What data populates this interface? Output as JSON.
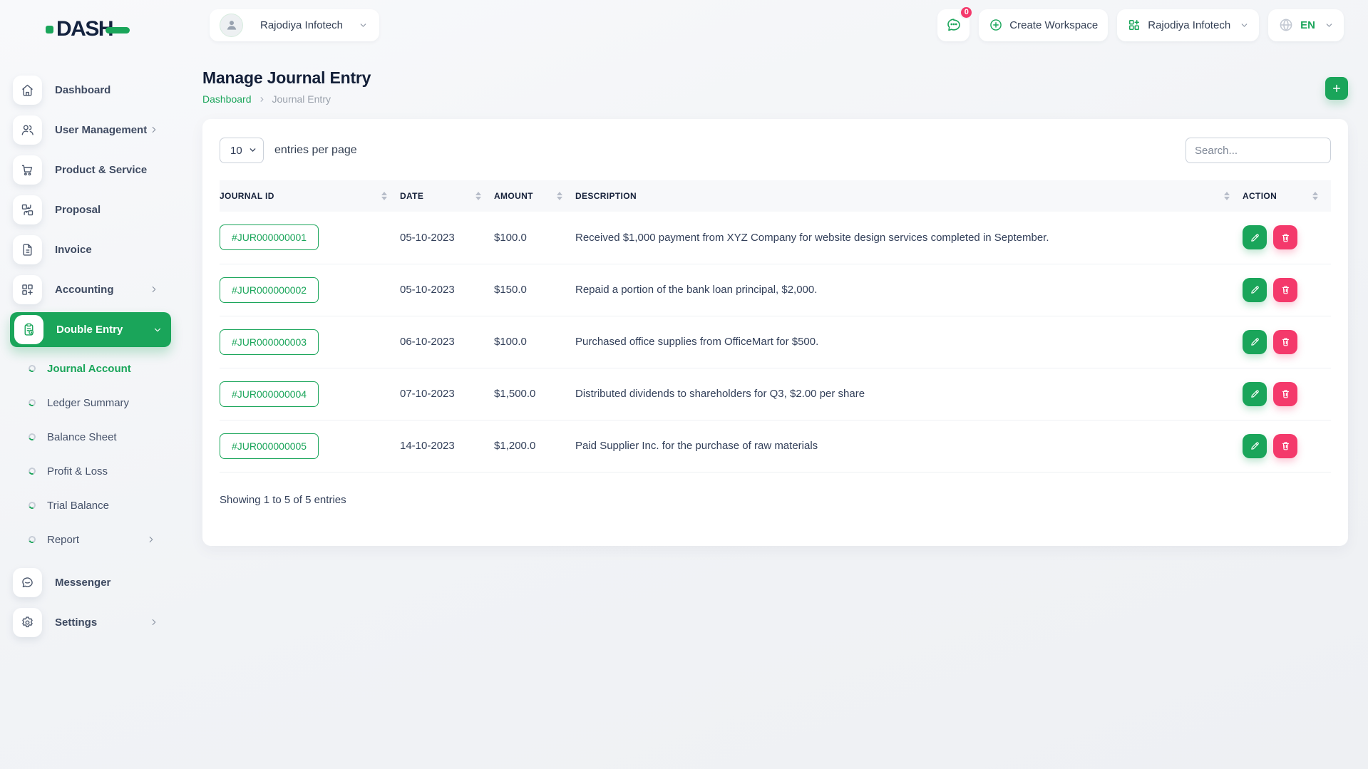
{
  "colors": {
    "accent": "#1aa55a",
    "danger": "#f4396b"
  },
  "brand": {
    "name": "DASH"
  },
  "topbar": {
    "workspace_left": "Rajodiya Infotech",
    "chat_badge": "0",
    "create_workspace_label": "Create Workspace",
    "workspace_right": "Rajodiya Infotech",
    "language_code": "EN"
  },
  "page": {
    "title": "Manage Journal Entry",
    "breadcrumb": {
      "home": "Dashboard",
      "current": "Journal Entry"
    }
  },
  "sidebar": {
    "items": [
      {
        "label": "Dashboard"
      },
      {
        "label": "User Management"
      },
      {
        "label": "Product & Service"
      },
      {
        "label": "Proposal"
      },
      {
        "label": "Invoice"
      },
      {
        "label": "Accounting"
      },
      {
        "label": "Double Entry"
      },
      {
        "label": "Messenger"
      },
      {
        "label": "Settings"
      }
    ],
    "double_entry_sub": [
      {
        "label": "Journal Account"
      },
      {
        "label": "Ledger Summary"
      },
      {
        "label": "Balance Sheet"
      },
      {
        "label": "Profit & Loss"
      },
      {
        "label": "Trial Balance"
      },
      {
        "label": "Report"
      }
    ]
  },
  "table_card": {
    "entries_select": "10",
    "entries_label": "entries per page",
    "search_placeholder": "Search...",
    "columns": {
      "journal_id": "JOURNAL ID",
      "date": "DATE",
      "amount": "AMOUNT",
      "description": "DESCRIPTION",
      "action": "ACTION"
    },
    "rows": [
      {
        "journal_id": "#JUR000000001",
        "date": "05-10-2023",
        "amount": "$100.0",
        "description": "Received $1,000 payment from XYZ Company for website design services completed in September."
      },
      {
        "journal_id": "#JUR000000002",
        "date": "05-10-2023",
        "amount": "$150.0",
        "description": "Repaid a portion of the bank loan principal, $2,000."
      },
      {
        "journal_id": "#JUR000000003",
        "date": "06-10-2023",
        "amount": "$100.0",
        "description": "Purchased office supplies from OfficeMart for $500."
      },
      {
        "journal_id": "#JUR000000004",
        "date": "07-10-2023",
        "amount": "$1,500.0",
        "description": "Distributed dividends to shareholders for Q3, $2.00 per share"
      },
      {
        "journal_id": "#JUR000000005",
        "date": "14-10-2023",
        "amount": "$1,200.0",
        "description": "Paid Supplier Inc. for the purchase of raw materials"
      }
    ],
    "footer": "Showing 1 to 5 of 5 entries"
  }
}
